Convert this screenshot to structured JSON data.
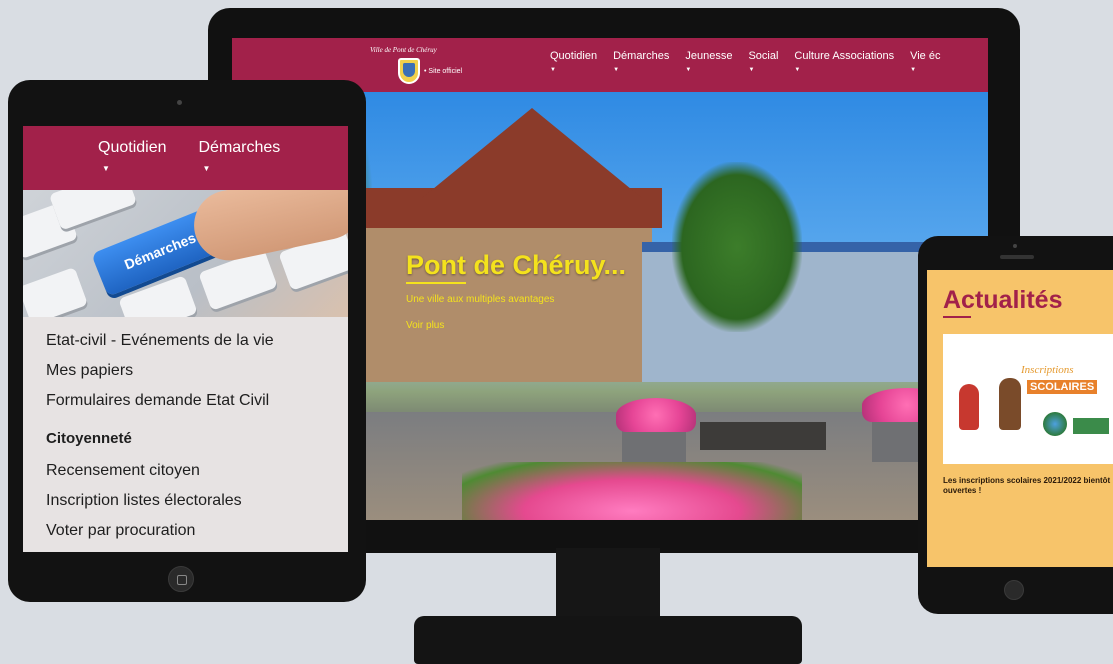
{
  "desktop": {
    "logo_text": "Ville de Pont de Chéruy",
    "logo_sub": "• Site officiel",
    "menu": [
      {
        "label": "Quotidien"
      },
      {
        "label": "Démarches"
      },
      {
        "label": "Jeunesse"
      },
      {
        "label": "Social"
      },
      {
        "label": "Culture Associations"
      },
      {
        "label": "Vie éc"
      }
    ],
    "caret": "▼",
    "hero": {
      "title": "Pont de Chéruy...",
      "subtitle": "Une ville aux multiples avantages",
      "more": "Voir plus"
    }
  },
  "tablet": {
    "menu": [
      {
        "label": "Quotidien"
      },
      {
        "label": "Démarches"
      }
    ],
    "caret": "▼",
    "image_key_label": "Démarches",
    "links": [
      "Etat-civil - Evénements de la vie",
      "Mes papiers",
      "Formulaires demande Etat Civil"
    ],
    "section_title": "Citoyenneté",
    "section_links": [
      "Recensement citoyen",
      "Inscription listes électorales",
      "Voter par procuration"
    ]
  },
  "phone": {
    "title": "Actualités",
    "card_script": "Inscriptions",
    "card_banner": "SCOLAIRES",
    "caption": "Les inscriptions scolaires 2021/2022 bientôt ouvertes !"
  },
  "colors": {
    "brand": "#a2214a",
    "hero_accent": "#f4e21d",
    "phone_background": "#f7c46a"
  }
}
